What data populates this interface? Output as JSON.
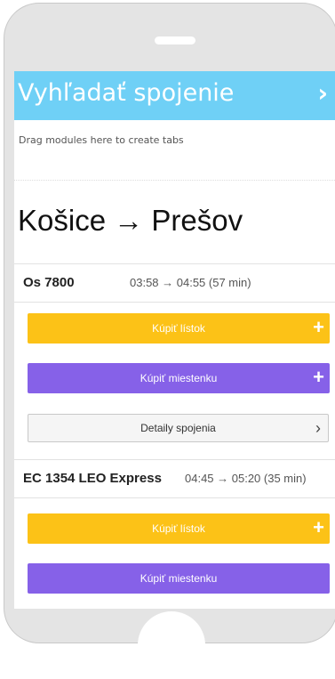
{
  "header": {
    "title": "Vyhľadať spojenie",
    "chevron_glyph": "›"
  },
  "drag_hint": "Drag modules here to create tabs",
  "route": {
    "title": "Košice → Prešov"
  },
  "connections": [
    {
      "train": "Os 7800",
      "time": "03:58 → 04:55 (57 min)",
      "buy_ticket": "Kúpiť lístok",
      "buy_seat": "Kúpiť miestenku",
      "details": "Detaily spojenia"
    },
    {
      "train": "EC 1354 LEO Express",
      "time": "04:45 → 05:20 (35 min)",
      "buy_ticket": "Kúpiť lístok",
      "buy_seat": "Kúpiť miestenku"
    }
  ],
  "icons": {
    "plus": "+",
    "details_arrow": "›"
  },
  "colors": {
    "header": "#6fd0f6",
    "buy_ticket": "#fcc217",
    "buy_seat": "#8661e8"
  }
}
